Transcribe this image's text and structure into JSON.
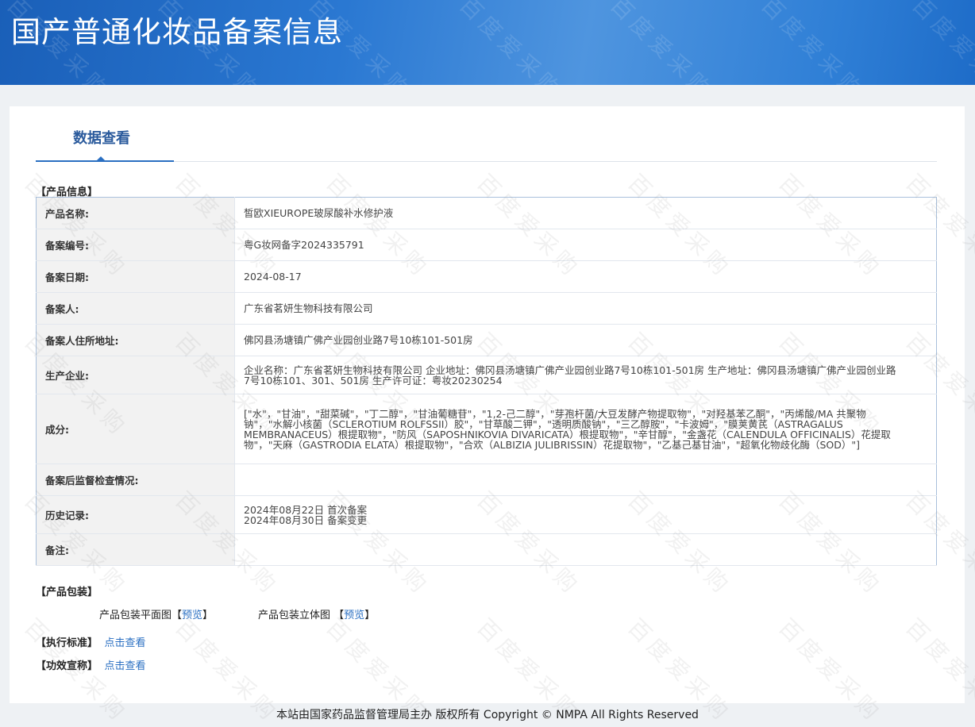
{
  "header": {
    "title": "国产普通化妆品备案信息"
  },
  "tab": {
    "label": "数据查看"
  },
  "sections": {
    "product_info": "【产品信息】",
    "packaging": "【产品包装】",
    "standard": "【执行标准】",
    "claims": "【功效宣称】"
  },
  "fields": [
    {
      "key": "产品名称:",
      "value": "皙欧XIEUROPE玻尿酸补水修护液"
    },
    {
      "key": "备案编号:",
      "value": "粤G妆网备字2024335791"
    },
    {
      "key": "备案日期:",
      "value": "2024-08-17"
    },
    {
      "key": "备案人:",
      "value": "广东省茗妍生物科技有限公司"
    },
    {
      "key": "备案人住所地址:",
      "value": "佛冈县汤塘镇广佛产业园创业路7号10栋101-501房"
    },
    {
      "key": "生产企业:",
      "value": "企业名称：广东省茗妍生物科技有限公司 企业地址：佛冈县汤塘镇广佛产业园创业路7号10栋101-501房 生产地址：佛冈县汤塘镇广佛产业园创业路7号10栋101、301、501房 生产许可证：粤妆20230254"
    },
    {
      "key": "成分:",
      "value": "[\"水\"，\"甘油\"，\"甜菜碱\"，\"丁二醇\"，\"甘油葡糖苷\"，\"1,2-己二醇\"，\"芽孢杆菌/大豆发酵产物提取物\"，\"对羟基苯乙酮\"，\"丙烯酸/MA 共聚物钠\"，\"水解小核菌（SCLEROTIUM ROLFSSII）胶\"，\"甘草酸二钾\"，\"透明质酸钠\"，\"三乙醇胺\"，\"卡波姆\"，\"膜荚黄芪（ASTRAGALUS MEMBRANACEUS）根提取物\"，\"防风（SAPOSHNIKOVIA DIVARICATA）根提取物\"，\"辛甘醇\"，\"金盏花（CALENDULA OFFICINALIS）花提取物\"，\"天麻（GASTRODIA ELATA）根提取物\"，\"合欢（ALBIZIA JULIBRISSIN）花提取物\"，\"乙基己基甘油\"，\"超氧化物歧化酶（SOD）\"]"
    },
    {
      "key": "备案后监督检查情况:",
      "value": ""
    },
    {
      "key": "历史记录:",
      "value": "",
      "lines": [
        "2024年08月22日 首次备案",
        "2024年08月30日 备案变更"
      ]
    },
    {
      "key": "备注:",
      "value": ""
    }
  ],
  "packaging": {
    "flat_label": "产品包装平面图",
    "solid_label": "产品包装立体图",
    "preview_label": "预览",
    "bracket_open": "【",
    "bracket_close": "】"
  },
  "links": {
    "view": "点击查看"
  },
  "footer": {
    "text": "本站由国家药品监督管理局主办 版权所有 Copyright © NMPA All Rights Reserved"
  },
  "watermark": "百度爱采购"
}
